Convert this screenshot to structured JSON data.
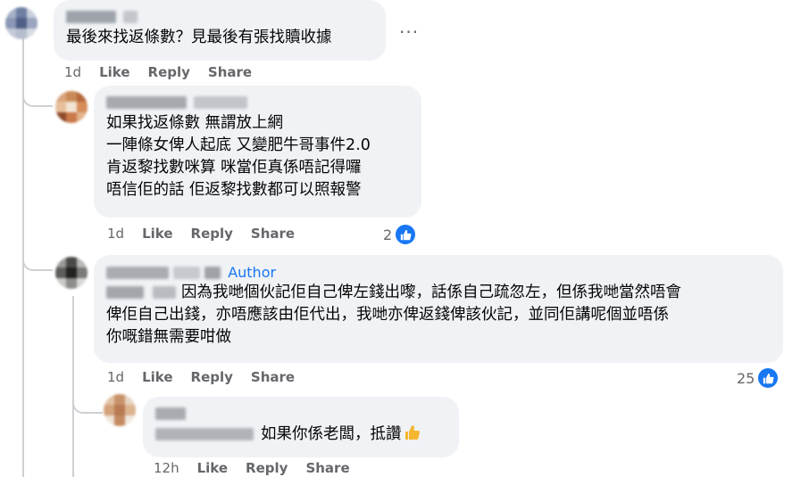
{
  "comments": [
    {
      "text": "最後來找返條數？見最後有張找贖收據",
      "time": "1d",
      "like_label": "Like",
      "reply_label": "Reply",
      "share_label": "Share",
      "more_label": "···"
    },
    {
      "text": "如果找返條數 無謂放上網\n一陣條女俾人起底 又變肥牛哥事件2.0\n肯返黎找數咪算 咪當佢真係唔記得囉\n唔信佢的話 佢返黎找數都可以照報警",
      "time": "1d",
      "like_label": "Like",
      "reply_label": "Reply",
      "share_label": "Share",
      "reaction_count": "2"
    },
    {
      "author_tag": "Author",
      "text_line1": "因為我哋個伙記佢自己俾左錢出嚟，話係自己疏忽左，但係我哋當然唔會",
      "text_rest": "俾佢自己出錢，亦唔應該由佢代出，我哋亦俾返錢俾該伙記，並同佢講呢個並唔係\n你嘅錯無需要咁做",
      "time": "1d",
      "like_label": "Like",
      "reply_label": "Reply",
      "share_label": "Share",
      "reaction_count": "25"
    },
    {
      "text": "如果你係老闆，抵讚",
      "time": "12h",
      "like_label": "Like",
      "reply_label": "Reply",
      "share_label": "Share"
    }
  ],
  "icons": {
    "like": "thumbs-up-icon",
    "thumb_emoji": "thumbs-up-emoji-icon"
  },
  "colors": {
    "bubble": "#f0f2f5",
    "like_blue": "#1877f2",
    "meta_gray": "#65676b"
  }
}
